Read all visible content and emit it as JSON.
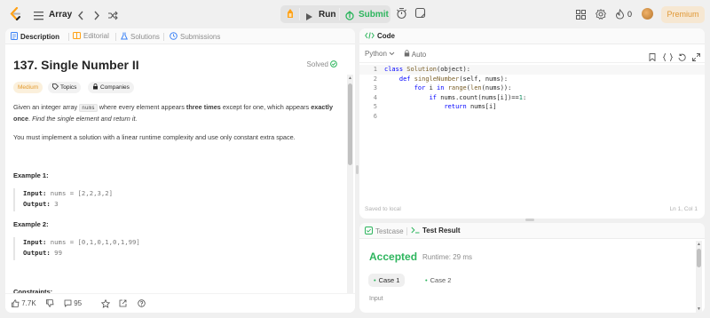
{
  "nav": {
    "list_label": "Array",
    "run_label": "Run",
    "submit_label": "Submit",
    "streak_count": "0",
    "premium_label": "Premium"
  },
  "left_tabs": [
    {
      "label": "Description"
    },
    {
      "label": "Editorial"
    },
    {
      "label": "Solutions"
    },
    {
      "label": "Submissions"
    }
  ],
  "problem": {
    "title": "137. Single Number II",
    "status": "Solved",
    "difficulty": "Medium",
    "topics_label": "Topics",
    "companies_label": "Companies",
    "desc_1": "Given an integer array",
    "desc_code": "nums",
    "desc_2": "where every element appears",
    "desc_bold_1": "three times",
    "desc_3": "except for one, which appears",
    "desc_bold_2": "exactly once",
    "desc_4": ".",
    "desc_italic": "Find the single element and return it.",
    "desc_p2": "You must implement a solution with a linear runtime complexity and use only constant extra space.",
    "examples": [
      {
        "title": "Example 1:",
        "input_label": "Input:",
        "input_value": "nums = [2,2,3,2]",
        "output_label": "Output:",
        "output_value": "3"
      },
      {
        "title": "Example 2:",
        "input_label": "Input:",
        "input_value": "nums = [0,1,0,1,0,1,99]",
        "output_label": "Output:",
        "output_value": "99"
      }
    ],
    "constraints_title": "Constraints:"
  },
  "bottom_bar": {
    "likes": "7.7K",
    "comments": "95"
  },
  "code_panel": {
    "tab_label": "Code",
    "language": "Python",
    "auto_label": "Auto",
    "saved_text": "Saved to local",
    "cursor_pos": "Ln 1, Col 1",
    "line_numbers": [
      "1",
      "2",
      "3",
      "4",
      "5",
      "6"
    ]
  },
  "test_panel": {
    "testcase_label": "Testcase",
    "result_label": "Test Result",
    "status": "Accepted",
    "runtime": "Runtime: 29 ms",
    "cases": [
      "Case 1",
      "Case 2"
    ],
    "input_label": "Input"
  }
}
